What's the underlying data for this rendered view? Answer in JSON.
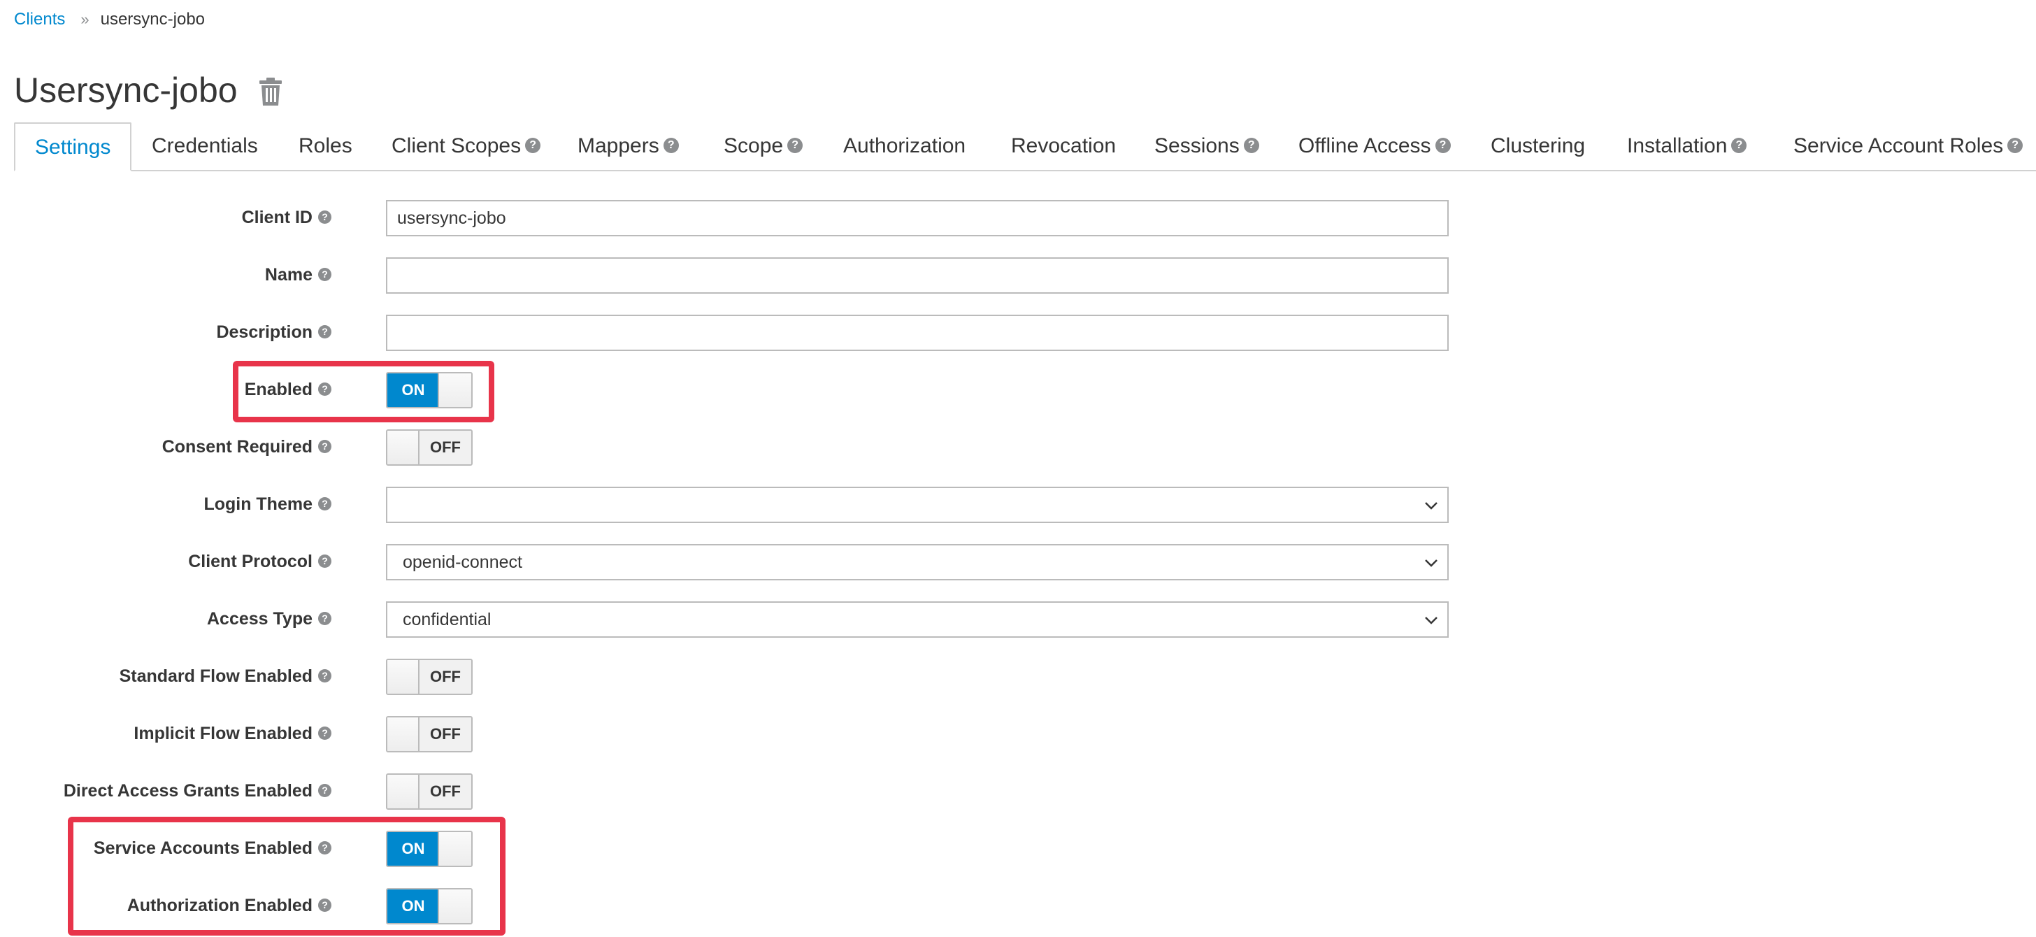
{
  "breadcrumb": {
    "parent": "Clients",
    "separator": "»",
    "current": "usersync-jobo"
  },
  "page_title": "Usersync-jobo",
  "tabs": [
    {
      "label": "Settings",
      "help": false,
      "active": true
    },
    {
      "label": "Credentials",
      "help": false
    },
    {
      "label": "Roles",
      "help": false
    },
    {
      "label": "Client Scopes",
      "help": true
    },
    {
      "label": "Mappers",
      "help": true
    },
    {
      "label": "Scope",
      "help": true
    },
    {
      "label": "Authorization",
      "help": false
    },
    {
      "label": "Revocation",
      "help": false
    },
    {
      "label": "Sessions",
      "help": true
    },
    {
      "label": "Offline Access",
      "help": true
    },
    {
      "label": "Clustering",
      "help": false
    },
    {
      "label": "Installation",
      "help": true
    },
    {
      "label": "Service Account Roles",
      "help": true
    }
  ],
  "form": {
    "client_id": {
      "label": "Client ID",
      "value": "usersync-jobo"
    },
    "name": {
      "label": "Name",
      "value": ""
    },
    "description": {
      "label": "Description",
      "value": ""
    },
    "enabled": {
      "label": "Enabled",
      "state": "ON"
    },
    "consent_required": {
      "label": "Consent Required",
      "state": "OFF"
    },
    "login_theme": {
      "label": "Login Theme",
      "value": ""
    },
    "client_protocol": {
      "label": "Client Protocol",
      "value": "openid-connect"
    },
    "access_type": {
      "label": "Access Type",
      "value": "confidential"
    },
    "standard_flow": {
      "label": "Standard Flow Enabled",
      "state": "OFF"
    },
    "implicit_flow": {
      "label": "Implicit Flow Enabled",
      "state": "OFF"
    },
    "direct_access": {
      "label": "Direct Access Grants Enabled",
      "state": "OFF"
    },
    "service_accounts": {
      "label": "Service Accounts Enabled",
      "state": "ON"
    },
    "authorization": {
      "label": "Authorization Enabled",
      "state": "ON"
    }
  },
  "colors": {
    "accent": "#0088ce",
    "highlight": "#e8344a",
    "text": "#363636",
    "border": "#bbbbbb"
  },
  "icons": {
    "delete": "trash-icon",
    "help": "question-circle-icon",
    "dropdown": "chevron-down-icon"
  }
}
